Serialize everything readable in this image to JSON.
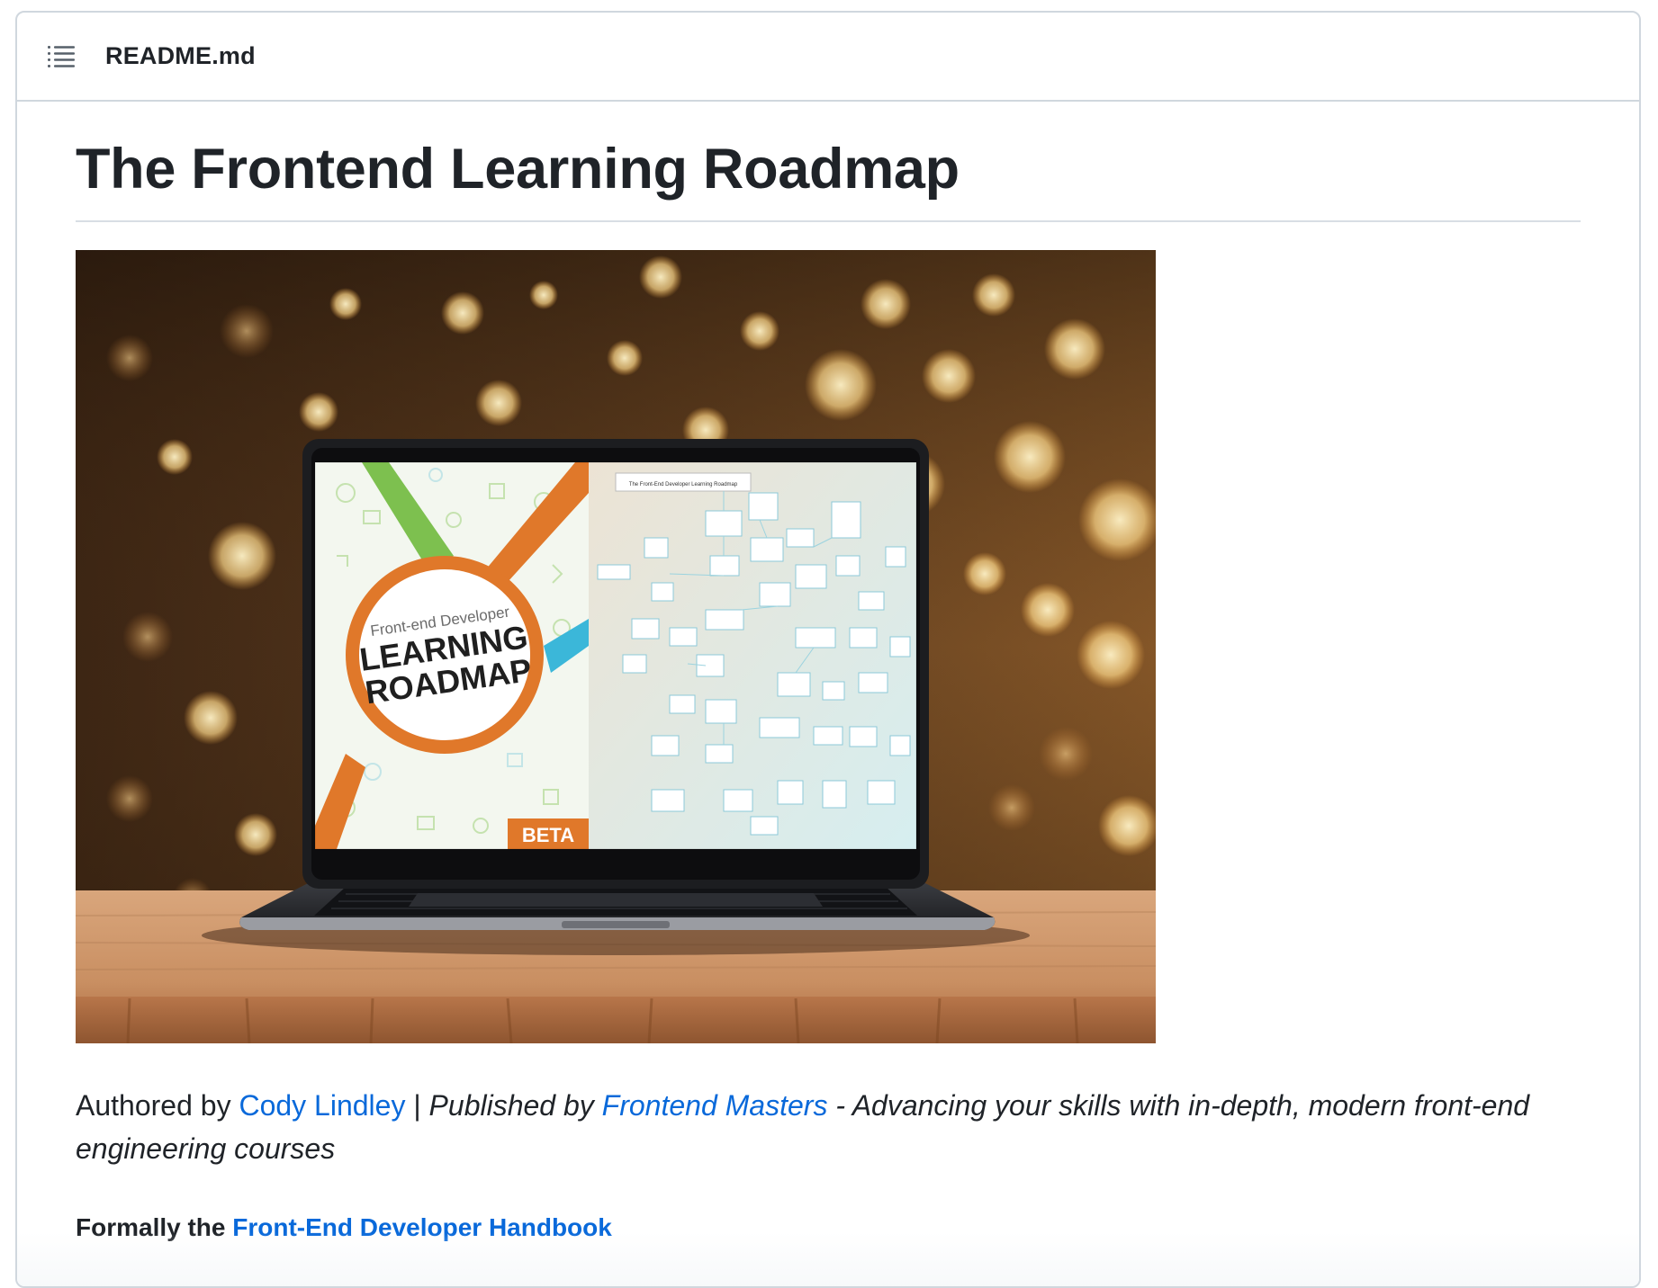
{
  "header": {
    "toc_icon": "list-unordered-icon",
    "file_name": "README.md"
  },
  "readme": {
    "title": "The Frontend Learning Roadmap",
    "hero": {
      "screen_left_title_small": "Front-end Developer",
      "screen_left_title_line1": "LEARNING",
      "screen_left_title_line2": "ROADMAP",
      "screen_badge": "BETA",
      "screen_right_heading": "The Front-End Developer Learning Roadmap"
    },
    "author_line": {
      "prefix": "Authored by ",
      "author_link": "Cody Lindley",
      "separator": " | ",
      "published_prefix": "Published by ",
      "publisher_link": "Frontend Masters",
      "tagline": " - Advancing your skills with in-depth, modern front-end engineering courses"
    },
    "formerly": {
      "prefix": "Formally the ",
      "link": "Front-End Developer Handbook"
    }
  },
  "colors": {
    "link": "#0969da",
    "text": "#1f2328",
    "border": "#d0d7de",
    "roadmap_orange": "#e0782a",
    "roadmap_green": "#7dc04f",
    "roadmap_blue": "#3bb7d9"
  }
}
